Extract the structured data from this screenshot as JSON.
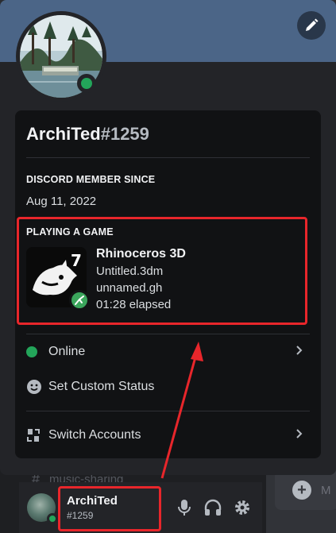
{
  "profile": {
    "username": "ArchiTed",
    "discriminator": "#1259",
    "status": "online"
  },
  "member_since": {
    "heading": "DISCORD MEMBER SINCE",
    "date": "Aug 11, 2022"
  },
  "activity": {
    "heading": "PLAYING A GAME",
    "game_name": "Rhinoceros 3D",
    "details": "Untitled.3dm",
    "state": "unnamed.gh",
    "elapsed": "01:28 elapsed",
    "icon_number": "7"
  },
  "menu": {
    "online_label": "Online",
    "custom_status_label": "Set Custom Status",
    "switch_accounts_label": "Switch Accounts"
  },
  "user_panel": {
    "name": "ArchiTed",
    "tag": "#1259"
  },
  "background": {
    "channel_name": "music-sharing"
  },
  "colors": {
    "online": "#23a55a",
    "annotation_red": "#e8262b",
    "banner": "#4b6587"
  }
}
